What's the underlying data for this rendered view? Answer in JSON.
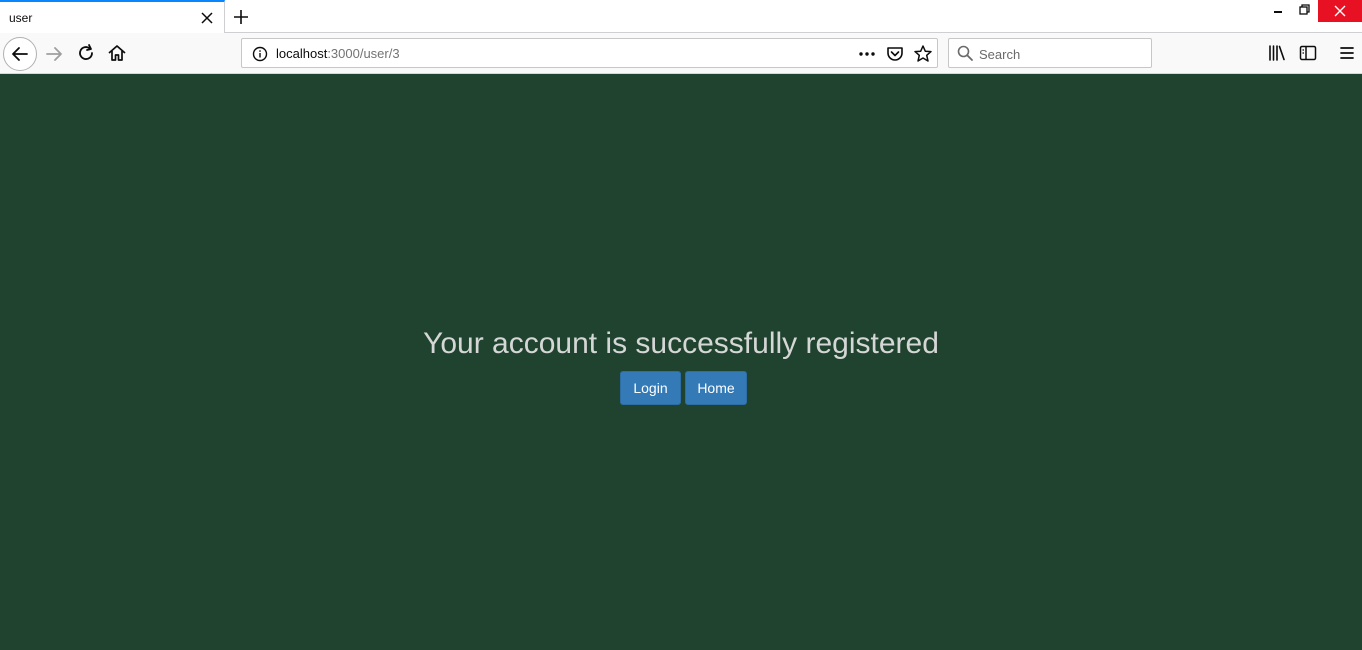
{
  "browser": {
    "tab": {
      "title": "user",
      "close_icon": "close-icon"
    },
    "new_tab_icon": "plus-icon",
    "window_controls": [
      "minimize-icon",
      "restore-icon",
      "close-icon"
    ],
    "nav": {
      "back_icon": "arrow-left-icon",
      "forward_icon": "arrow-right-icon",
      "reload_icon": "reload-icon",
      "home_icon": "home-icon"
    },
    "url": {
      "host": "localhost",
      "rest": ":3000/user/3"
    },
    "search": {
      "placeholder": "Search"
    },
    "toolbar_icons": [
      "page-actions-icon",
      "pocket-icon",
      "bookmark-star-icon",
      "library-icon",
      "sidebar-icon",
      "menu-icon"
    ]
  },
  "page": {
    "background_color": "#20432f",
    "message": "Your account is successfully registered",
    "buttons": {
      "login_label": "Login",
      "home_label": "Home",
      "color": "#337ab7"
    }
  }
}
